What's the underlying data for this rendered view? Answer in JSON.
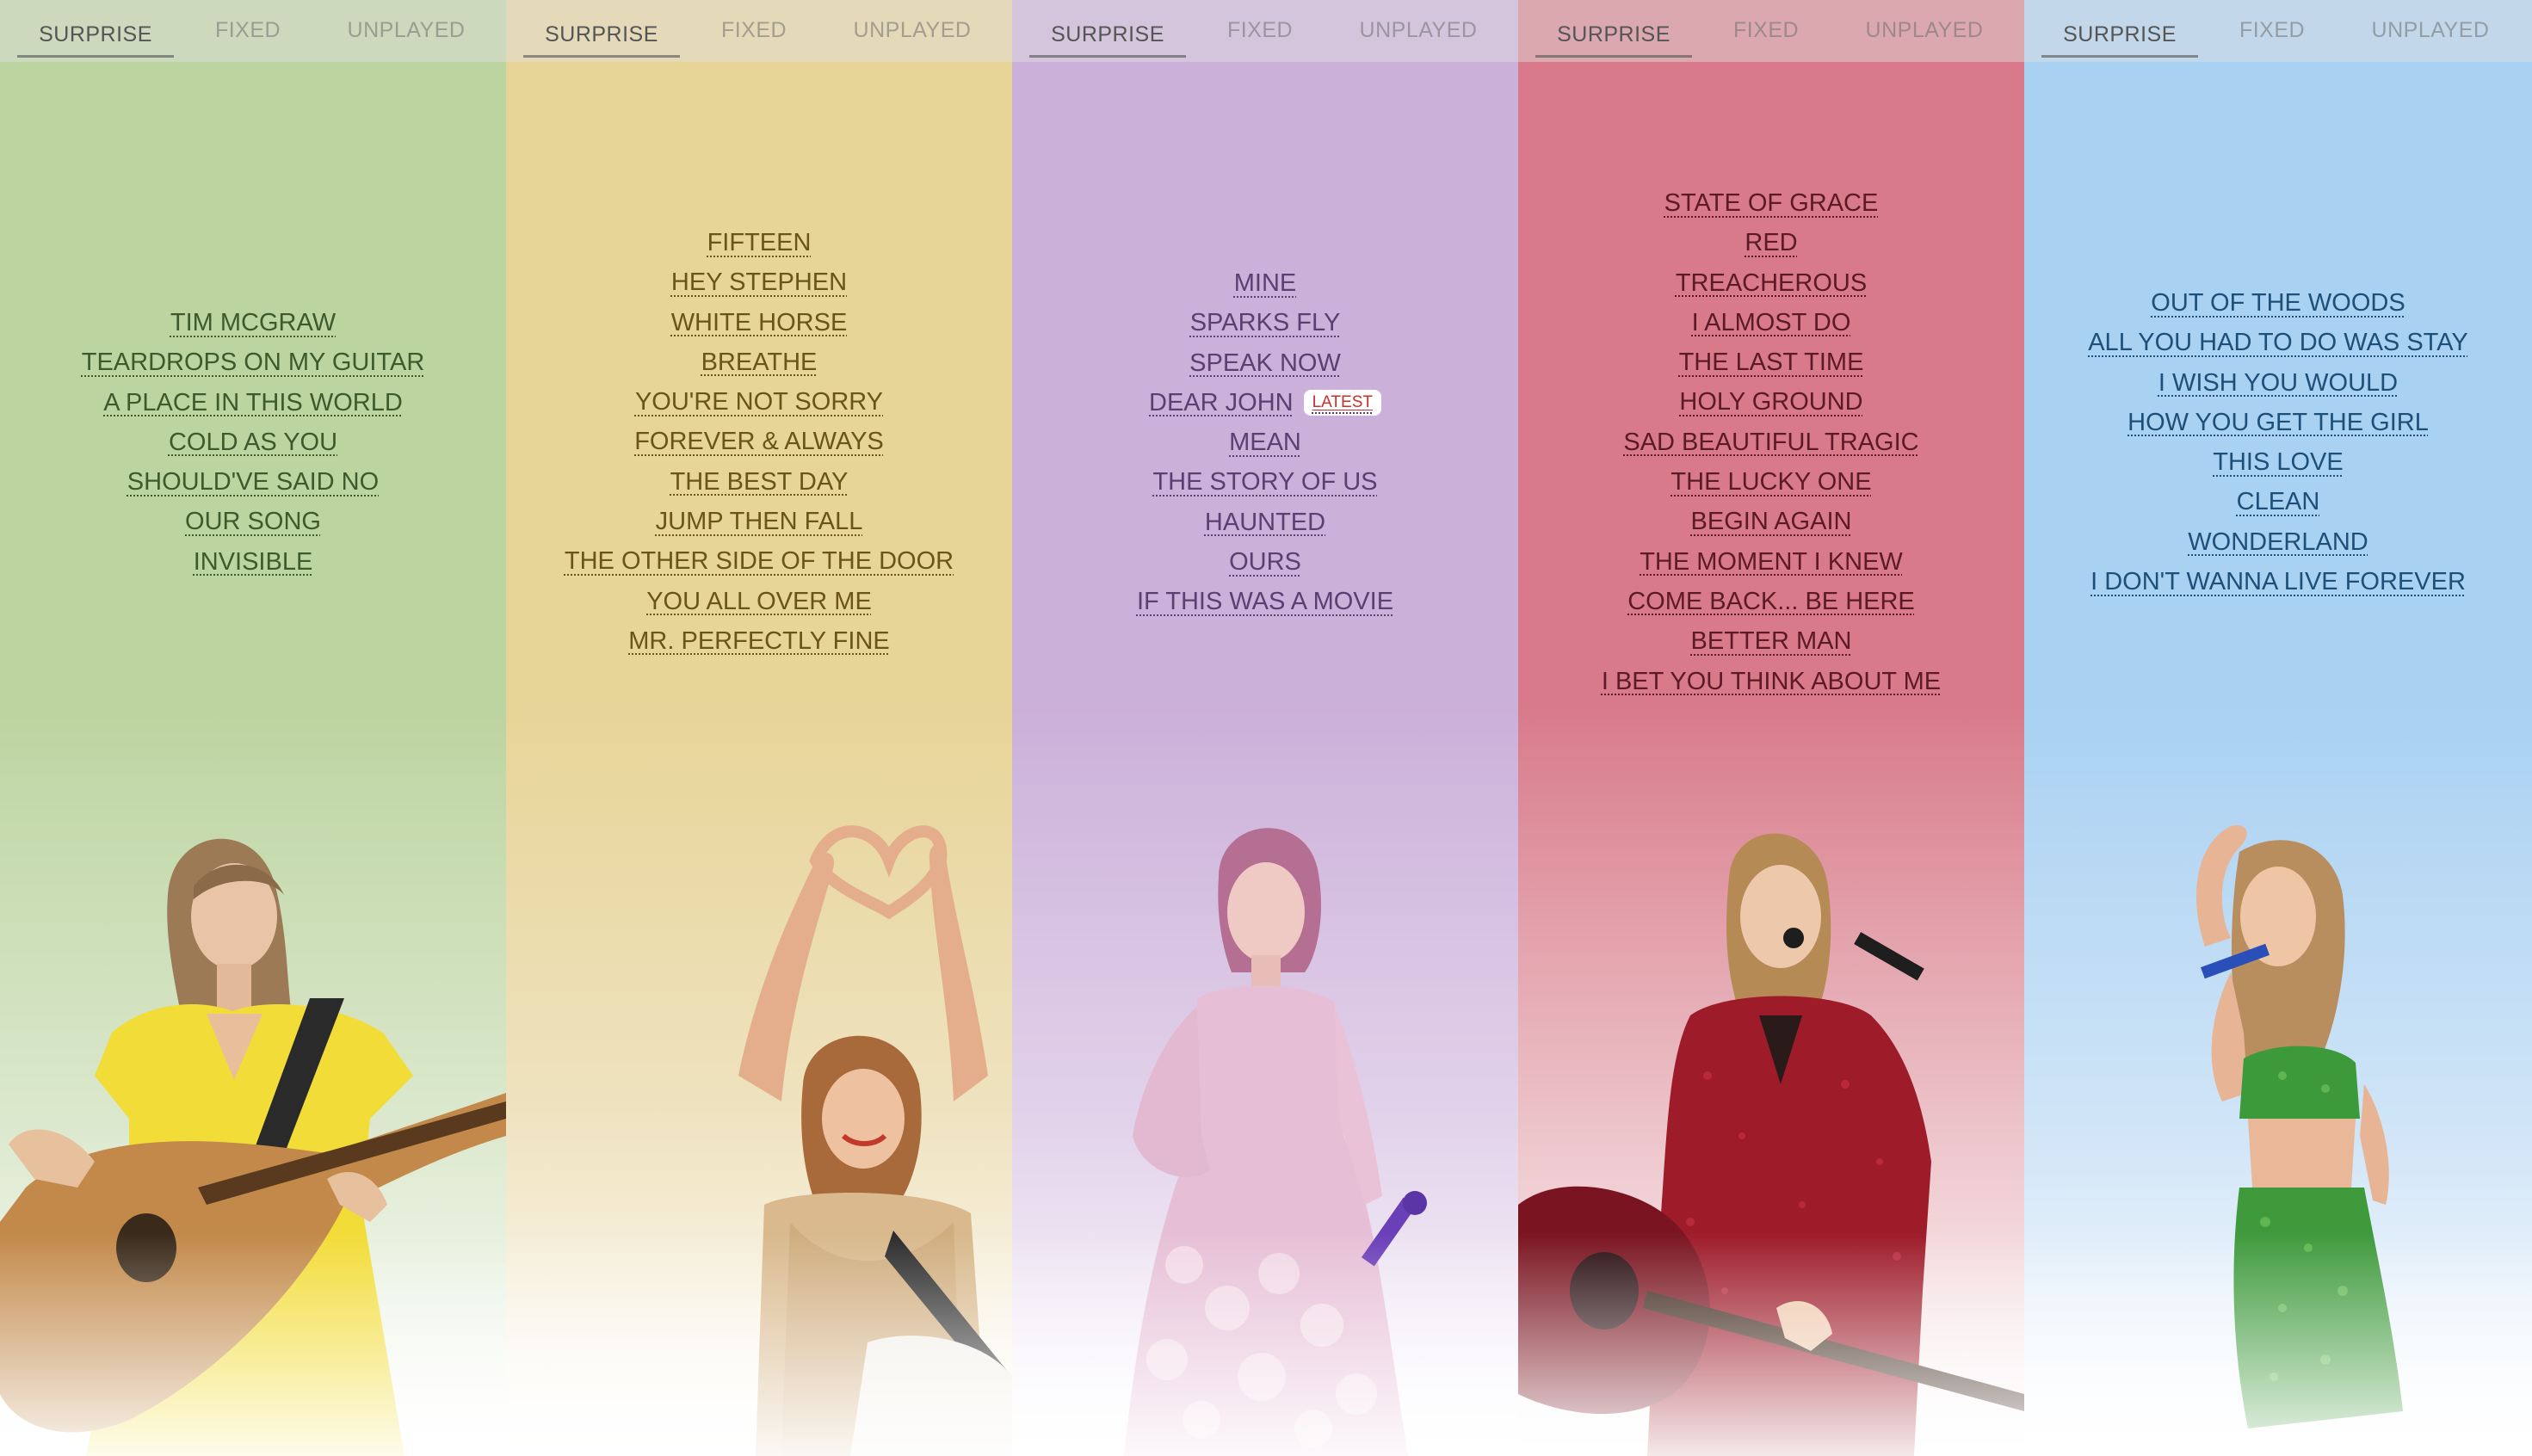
{
  "tabs": {
    "surprise": "SURPRISE",
    "fixed": "FIXED",
    "unplayed": "UNPLAYED"
  },
  "latest_badge": "LATEST",
  "colors": {
    "col1": "#bcd4a0",
    "col2": "#e7d497",
    "col3": "#cbb0d9",
    "col4": "#d87a89",
    "col5": "#a9d1f2",
    "text1": "#3c5a2c",
    "text2": "#6a5418",
    "text3": "#5b3f72",
    "text4": "#5c1a26",
    "text5": "#1e4f78",
    "badge": "#c9302c"
  },
  "columns": [
    {
      "songs": [
        "TIM MCGRAW",
        "TEARDROPS ON MY GUITAR",
        "A PLACE IN THIS WORLD",
        "COLD AS YOU",
        "SHOULD'VE SAID NO",
        "OUR SONG",
        "INVISIBLE"
      ]
    },
    {
      "songs": [
        "FIFTEEN",
        "HEY STEPHEN",
        "WHITE HORSE",
        "BREATHE",
        "YOU'RE NOT SORRY",
        "FOREVER & ALWAYS",
        "THE BEST DAY",
        "JUMP THEN FALL",
        "THE OTHER SIDE OF THE DOOR",
        "YOU ALL OVER ME",
        "MR. PERFECTLY FINE"
      ]
    },
    {
      "songs": [
        "MINE",
        "SPARKS FLY",
        "SPEAK NOW",
        "DEAR JOHN",
        "MEAN",
        "THE STORY OF US",
        "HAUNTED",
        "OURS",
        "IF THIS WAS A MOVIE"
      ]
    },
    {
      "songs": [
        "STATE OF GRACE",
        "RED",
        "TREACHEROUS",
        "I ALMOST DO",
        "THE LAST TIME",
        "HOLY GROUND",
        "SAD BEAUTIFUL TRAGIC",
        "THE LUCKY ONE",
        "BEGIN AGAIN",
        "THE MOMENT I KNEW",
        "COME BACK... BE HERE",
        "BETTER MAN",
        "I BET YOU THINK ABOUT ME"
      ]
    },
    {
      "songs": [
        "OUT OF THE WOODS",
        "ALL YOU HAD TO DO WAS STAY",
        "I WISH YOU WOULD",
        "HOW YOU GET THE GIRL",
        "THIS LOVE",
        "CLEAN",
        "WONDERLAND",
        "I DON'T WANNA LIVE FOREVER"
      ]
    }
  ]
}
